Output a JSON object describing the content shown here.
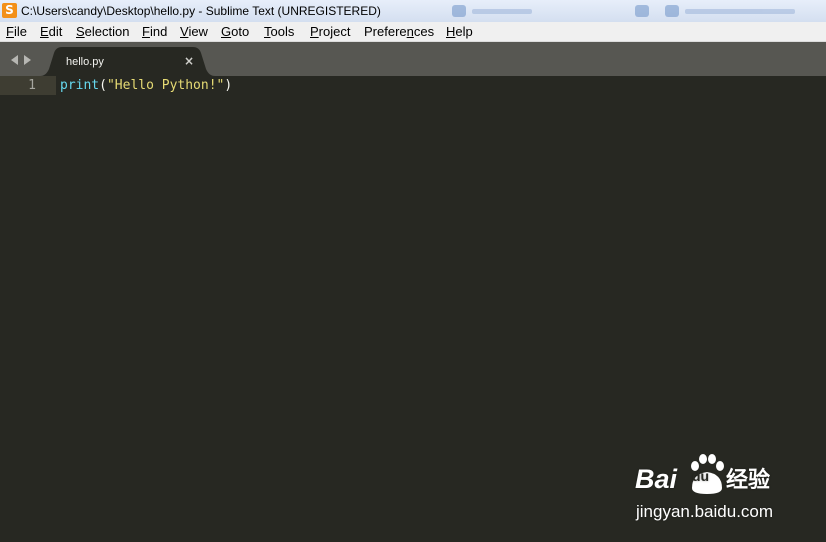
{
  "window": {
    "title": "C:\\Users\\candy\\Desktop\\hello.py - Sublime Text (UNREGISTERED)",
    "app_icon": "S"
  },
  "menu": [
    {
      "label": "File",
      "underline": "F",
      "rest": "ile"
    },
    {
      "label": "Edit",
      "underline": "E",
      "rest": "dit"
    },
    {
      "label": "Selection",
      "underline": "S",
      "rest": "election"
    },
    {
      "label": "Find",
      "underline": "F",
      "rest": "ind"
    },
    {
      "label": "View",
      "underline": "V",
      "rest": "iew"
    },
    {
      "label": "Goto",
      "underline": "G",
      "rest": "oto"
    },
    {
      "label": "Tools",
      "underline": "T",
      "rest": "ools"
    },
    {
      "label": "Project",
      "underline": "P",
      "rest": "roject"
    },
    {
      "label": "Preferences",
      "underline": "n",
      "pre": "Prefere",
      "rest": "ces"
    },
    {
      "label": "Help",
      "underline": "H",
      "rest": "elp"
    }
  ],
  "tabs": [
    {
      "label": "hello.py",
      "close": "×",
      "active": true
    }
  ],
  "editor": {
    "lines": [
      {
        "number": "1",
        "tokens": {
          "fn": "print",
          "open": "(",
          "str": "\"Hello Python!\"",
          "close": ")"
        }
      }
    ]
  },
  "watermark": {
    "brand": "Bai",
    "paw_text": "du",
    "product": "经验",
    "url": "jingyan.baidu.com"
  },
  "colors": {
    "editor_bg": "#272822",
    "function": "#66d9ef",
    "string": "#e6db74",
    "punctuation": "#f8f8f2",
    "tabbar_bg": "#575752",
    "app_icon_bg": "#f39019"
  }
}
